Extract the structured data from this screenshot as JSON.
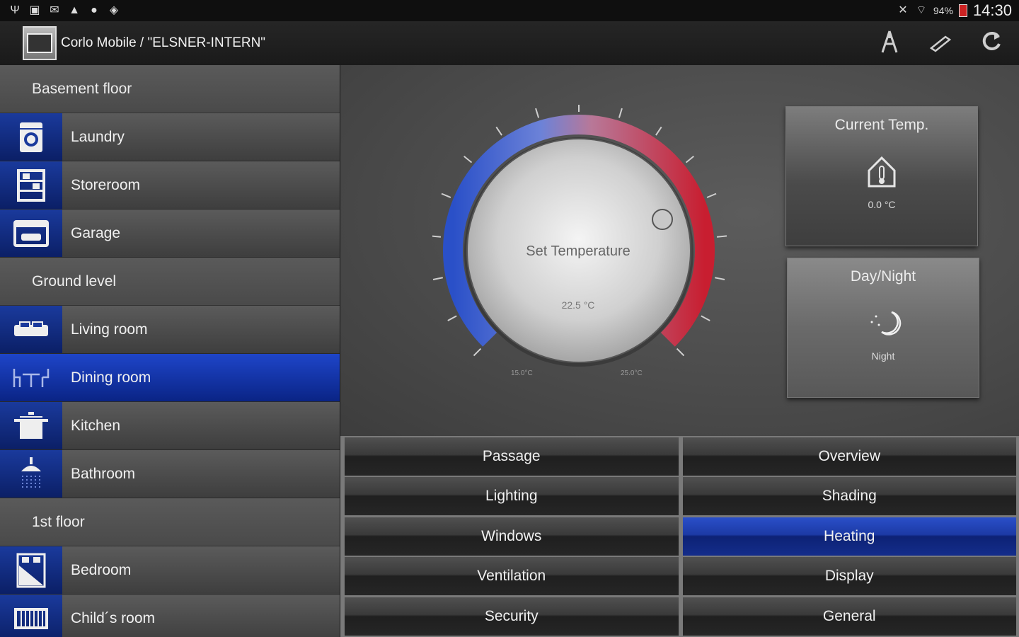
{
  "status_bar": {
    "left_icons": [
      "usb-icon",
      "image-icon",
      "message-icon",
      "warning-icon",
      "chat-icon",
      "gallery-icon"
    ],
    "battery": "94%",
    "time": "14:30"
  },
  "action_bar": {
    "title": "Corlo Mobile / \"ELSNER-INTERN\"",
    "actions": [
      "user-icon",
      "pen-icon",
      "refresh-icon"
    ]
  },
  "sidebar": {
    "sections": [
      {
        "title": "Basement floor",
        "rooms": [
          "Laundry",
          "Storeroom",
          "Garage"
        ]
      },
      {
        "title": "Ground level",
        "rooms": [
          "Living room",
          "Dining room",
          "Kitchen",
          "Bathroom"
        ]
      },
      {
        "title": "1st floor",
        "rooms": [
          "Bedroom",
          "Child´s room"
        ]
      }
    ],
    "selected_room": "Dining room",
    "accent": "#0b2a9a"
  },
  "dial": {
    "label": "Set Temperature",
    "value": "22.5 °C",
    "min_label": "15.0°C",
    "max_label": "25.0°C"
  },
  "tiles": {
    "current_temp": {
      "title": "Current Temp.",
      "value": "0.0 °C"
    },
    "day_night": {
      "title": "Day/Night",
      "value": "Night"
    }
  },
  "functions": {
    "left": [
      "Passage",
      "Lighting",
      "Windows",
      "Ventilation",
      "Security"
    ],
    "right": [
      "Overview",
      "Shading",
      "Heating",
      "Display",
      "General"
    ],
    "active": "Heating"
  }
}
